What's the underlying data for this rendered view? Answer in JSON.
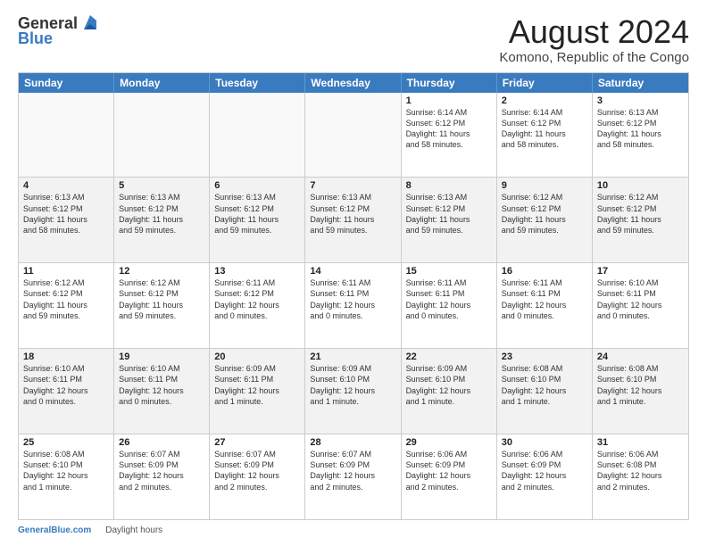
{
  "header": {
    "logo_general": "General",
    "logo_blue": "Blue",
    "month_title": "August 2024",
    "location": "Komono, Republic of the Congo"
  },
  "weekdays": [
    "Sunday",
    "Monday",
    "Tuesday",
    "Wednesday",
    "Thursday",
    "Friday",
    "Saturday"
  ],
  "rows": [
    [
      {
        "day": "",
        "info": "",
        "empty": true
      },
      {
        "day": "",
        "info": "",
        "empty": true
      },
      {
        "day": "",
        "info": "",
        "empty": true
      },
      {
        "day": "",
        "info": "",
        "empty": true
      },
      {
        "day": "1",
        "info": "Sunrise: 6:14 AM\nSunset: 6:12 PM\nDaylight: 11 hours\nand 58 minutes.",
        "empty": false
      },
      {
        "day": "2",
        "info": "Sunrise: 6:14 AM\nSunset: 6:12 PM\nDaylight: 11 hours\nand 58 minutes.",
        "empty": false
      },
      {
        "day": "3",
        "info": "Sunrise: 6:13 AM\nSunset: 6:12 PM\nDaylight: 11 hours\nand 58 minutes.",
        "empty": false
      }
    ],
    [
      {
        "day": "4",
        "info": "Sunrise: 6:13 AM\nSunset: 6:12 PM\nDaylight: 11 hours\nand 58 minutes.",
        "empty": false
      },
      {
        "day": "5",
        "info": "Sunrise: 6:13 AM\nSunset: 6:12 PM\nDaylight: 11 hours\nand 59 minutes.",
        "empty": false
      },
      {
        "day": "6",
        "info": "Sunrise: 6:13 AM\nSunset: 6:12 PM\nDaylight: 11 hours\nand 59 minutes.",
        "empty": false
      },
      {
        "day": "7",
        "info": "Sunrise: 6:13 AM\nSunset: 6:12 PM\nDaylight: 11 hours\nand 59 minutes.",
        "empty": false
      },
      {
        "day": "8",
        "info": "Sunrise: 6:13 AM\nSunset: 6:12 PM\nDaylight: 11 hours\nand 59 minutes.",
        "empty": false
      },
      {
        "day": "9",
        "info": "Sunrise: 6:12 AM\nSunset: 6:12 PM\nDaylight: 11 hours\nand 59 minutes.",
        "empty": false
      },
      {
        "day": "10",
        "info": "Sunrise: 6:12 AM\nSunset: 6:12 PM\nDaylight: 11 hours\nand 59 minutes.",
        "empty": false
      }
    ],
    [
      {
        "day": "11",
        "info": "Sunrise: 6:12 AM\nSunset: 6:12 PM\nDaylight: 11 hours\nand 59 minutes.",
        "empty": false
      },
      {
        "day": "12",
        "info": "Sunrise: 6:12 AM\nSunset: 6:12 PM\nDaylight: 11 hours\nand 59 minutes.",
        "empty": false
      },
      {
        "day": "13",
        "info": "Sunrise: 6:11 AM\nSunset: 6:12 PM\nDaylight: 12 hours\nand 0 minutes.",
        "empty": false
      },
      {
        "day": "14",
        "info": "Sunrise: 6:11 AM\nSunset: 6:11 PM\nDaylight: 12 hours\nand 0 minutes.",
        "empty": false
      },
      {
        "day": "15",
        "info": "Sunrise: 6:11 AM\nSunset: 6:11 PM\nDaylight: 12 hours\nand 0 minutes.",
        "empty": false
      },
      {
        "day": "16",
        "info": "Sunrise: 6:11 AM\nSunset: 6:11 PM\nDaylight: 12 hours\nand 0 minutes.",
        "empty": false
      },
      {
        "day": "17",
        "info": "Sunrise: 6:10 AM\nSunset: 6:11 PM\nDaylight: 12 hours\nand 0 minutes.",
        "empty": false
      }
    ],
    [
      {
        "day": "18",
        "info": "Sunrise: 6:10 AM\nSunset: 6:11 PM\nDaylight: 12 hours\nand 0 minutes.",
        "empty": false
      },
      {
        "day": "19",
        "info": "Sunrise: 6:10 AM\nSunset: 6:11 PM\nDaylight: 12 hours\nand 0 minutes.",
        "empty": false
      },
      {
        "day": "20",
        "info": "Sunrise: 6:09 AM\nSunset: 6:11 PM\nDaylight: 12 hours\nand 1 minute.",
        "empty": false
      },
      {
        "day": "21",
        "info": "Sunrise: 6:09 AM\nSunset: 6:10 PM\nDaylight: 12 hours\nand 1 minute.",
        "empty": false
      },
      {
        "day": "22",
        "info": "Sunrise: 6:09 AM\nSunset: 6:10 PM\nDaylight: 12 hours\nand 1 minute.",
        "empty": false
      },
      {
        "day": "23",
        "info": "Sunrise: 6:08 AM\nSunset: 6:10 PM\nDaylight: 12 hours\nand 1 minute.",
        "empty": false
      },
      {
        "day": "24",
        "info": "Sunrise: 6:08 AM\nSunset: 6:10 PM\nDaylight: 12 hours\nand 1 minute.",
        "empty": false
      }
    ],
    [
      {
        "day": "25",
        "info": "Sunrise: 6:08 AM\nSunset: 6:10 PM\nDaylight: 12 hours\nand 1 minute.",
        "empty": false
      },
      {
        "day": "26",
        "info": "Sunrise: 6:07 AM\nSunset: 6:09 PM\nDaylight: 12 hours\nand 2 minutes.",
        "empty": false
      },
      {
        "day": "27",
        "info": "Sunrise: 6:07 AM\nSunset: 6:09 PM\nDaylight: 12 hours\nand 2 minutes.",
        "empty": false
      },
      {
        "day": "28",
        "info": "Sunrise: 6:07 AM\nSunset: 6:09 PM\nDaylight: 12 hours\nand 2 minutes.",
        "empty": false
      },
      {
        "day": "29",
        "info": "Sunrise: 6:06 AM\nSunset: 6:09 PM\nDaylight: 12 hours\nand 2 minutes.",
        "empty": false
      },
      {
        "day": "30",
        "info": "Sunrise: 6:06 AM\nSunset: 6:09 PM\nDaylight: 12 hours\nand 2 minutes.",
        "empty": false
      },
      {
        "day": "31",
        "info": "Sunrise: 6:06 AM\nSunset: 6:08 PM\nDaylight: 12 hours\nand 2 minutes.",
        "empty": false
      }
    ]
  ],
  "footer": {
    "url": "GeneralBlue.com",
    "daylight_label": "Daylight hours"
  }
}
